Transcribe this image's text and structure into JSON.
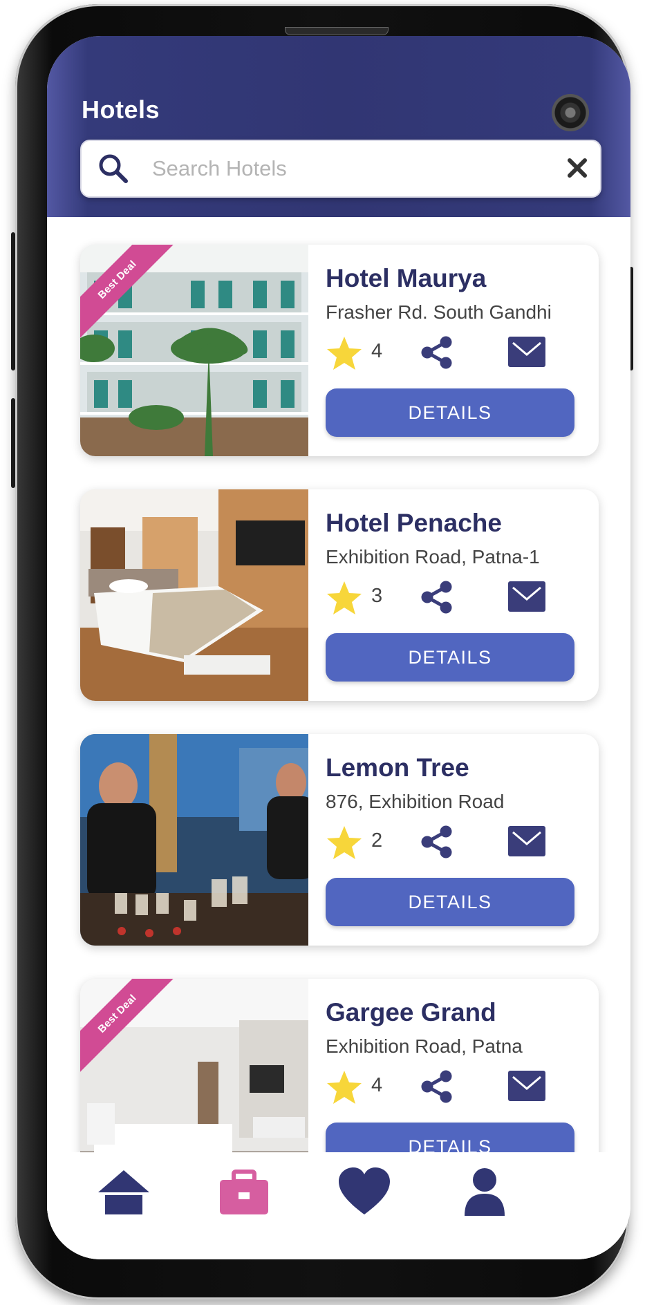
{
  "app": {
    "title": "Hotels"
  },
  "search": {
    "placeholder": "Search Hotels",
    "value": ""
  },
  "colors": {
    "header": "#313673",
    "accent": "#5166c0",
    "ribbon": "#d14b94",
    "star": "#f7d63a",
    "active_nav": "#d65ea0"
  },
  "hotels": [
    {
      "name": "Hotel Maurya",
      "address": "Frasher Rd. South Gandhi",
      "rating": "4",
      "badge": "Best Deal",
      "details_label": "DETAILS",
      "image": "hotel-facade-photo"
    },
    {
      "name": "Hotel Penache",
      "address": "Exhibition Road, Patna-1",
      "rating": "3",
      "badge": "",
      "details_label": "DETAILS",
      "image": "hotel-bedroom-photo"
    },
    {
      "name": "Lemon Tree",
      "address": "876, Exhibition Road",
      "rating": "2",
      "badge": "",
      "details_label": "DETAILS",
      "image": "hotel-bar-photo"
    },
    {
      "name": "Gargee Grand",
      "address": "Exhibition Road, Patna",
      "rating": "4",
      "badge": "Best Deal",
      "details_label": "DETAILS",
      "image": "hotel-room-photo"
    }
  ],
  "bottom_nav": [
    {
      "icon": "home-icon",
      "active": false
    },
    {
      "icon": "briefcase-icon",
      "active": true
    },
    {
      "icon": "heart-icon",
      "active": false
    },
    {
      "icon": "profile-icon",
      "active": false
    }
  ]
}
